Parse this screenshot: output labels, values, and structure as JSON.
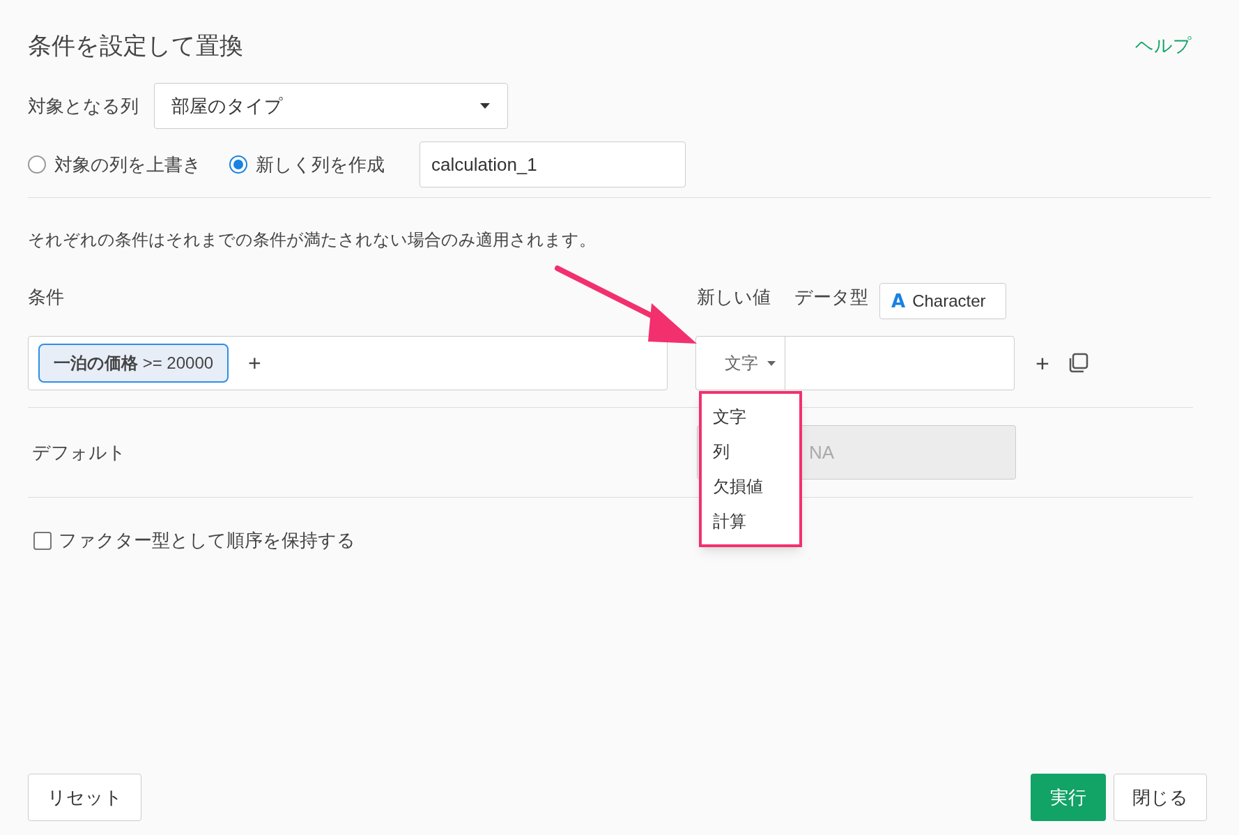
{
  "title": "条件を設定して置換",
  "help_link": "ヘルプ",
  "target_column": {
    "label": "対象となる列",
    "value": "部屋のタイプ"
  },
  "mode_options": [
    {
      "label": "対象の列を上書き",
      "selected": false
    },
    {
      "label": "新しく列を作成",
      "selected": true
    }
  ],
  "new_column_name": "calculation_1",
  "note": "それぞれの条件はそれまでの条件が満たされない場合のみ適用されます。",
  "conditions_label": "条件",
  "new_value_label": "新しい値",
  "data_type_label": "データ型",
  "data_type": {
    "icon": "A",
    "value": "Character"
  },
  "condition": {
    "column": "一泊の価格",
    "expression": ">= 20000",
    "add": "+"
  },
  "value_type": {
    "value": "文字",
    "expanded": true,
    "options": [
      {
        "label": "文字"
      },
      {
        "label": "列"
      },
      {
        "label": "欠損値"
      },
      {
        "label": "計算"
      }
    ]
  },
  "row_add": "+",
  "default": {
    "label": "デフォルト",
    "placeholder": "NA"
  },
  "keep_factor": {
    "label": "ファクター型として順序を保持する",
    "checked": false
  },
  "buttons": {
    "reset": "リセット",
    "run": "実行",
    "close": "閉じる"
  },
  "annotation_arrow": true
}
